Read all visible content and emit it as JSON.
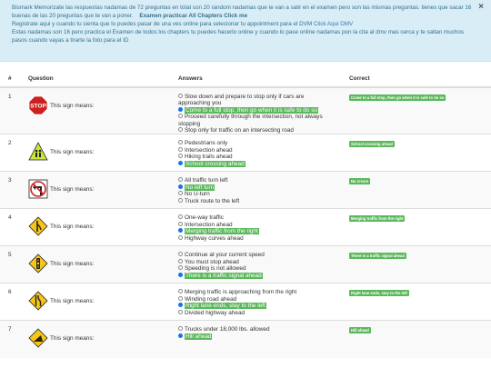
{
  "notice": {
    "line1": "Bismark Memorizate las respuestas nadamas de 72 preguntas en total son 20 random nadamas que te van a salir en el examen pero son las mismas preguntas. tienes que sacar 16 buenas de las 20 preguntas que te van a poner.",
    "cta": "Examen practicar All Chapters Click me",
    "line2": "Registrate aqui y cuando tu sienta que lo puedes pasar de una ves online para selecionar tu appointment para el DVM",
    "link": "Click Aqui DMV",
    "line3": "Estas nadamas son 16 pero practica el Examen de todos los chapters tu puedes hacerlo online y cuando lo pase online nadamas pon la cita al dmv mas cerca y te saltan muchos pasos cuando vayas a tirarte la foto para el ID",
    "close": "×"
  },
  "table": {
    "headers": [
      "#",
      "Question",
      "Answers",
      "Correct"
    ],
    "rows": [
      {
        "num": "1",
        "question": "This sign means:",
        "icon": "stop-sign-icon",
        "answers": [
          "Slow down and prepare to stop only if cars are approaching you",
          "Come to a full stop, then go when it is safe to do so",
          "Proceed carefully through the intersection, not always stopping",
          "Stop only for traffic on an intersecting road"
        ],
        "selected": 1,
        "correct": "Come to a full stop, then go when it is safe to do so"
      },
      {
        "num": "2",
        "question": "This sign means:",
        "icon": "school-crossing-sign-icon",
        "answers": [
          "Pedestrians only",
          "Intersection ahead",
          "Hiking trails ahead",
          "School crossing ahead"
        ],
        "selected": 3,
        "correct": "School crossing ahead"
      },
      {
        "num": "3",
        "question": "This sign means:",
        "icon": "no-left-turn-sign-icon",
        "answers": [
          "All traffic turn left",
          "No left turn",
          "No U-turn",
          "Truck route to the left"
        ],
        "selected": 1,
        "correct": "No U-turn"
      },
      {
        "num": "4",
        "question": "This sign means:",
        "icon": "merging-traffic-sign-icon",
        "answers": [
          "One-way traffic",
          "Intersection ahead",
          "Merging traffic from the right",
          "Highway curves ahead"
        ],
        "selected": 2,
        "correct": "Merging traffic from the right"
      },
      {
        "num": "5",
        "question": "This sign means:",
        "icon": "traffic-signal-ahead-sign-icon",
        "answers": [
          "Continue at your current speed",
          "You must stop ahead",
          "Speeding is not allowed",
          "There is a traffic signal ahead"
        ],
        "selected": 3,
        "correct": "There is a traffic signal ahead"
      },
      {
        "num": "6",
        "question": "This sign means:",
        "icon": "lane-ends-sign-icon",
        "answers": [
          "Merging traffic is approaching from the right",
          "Winding road ahead",
          "Right lane ends, stay to the left",
          "Divided highway ahead"
        ],
        "selected": 2,
        "correct": "Right lane ends, stay to the left"
      },
      {
        "num": "7",
        "question": "This sign means:",
        "icon": "hill-ahead-sign-icon",
        "answers": [
          "Trucks under 18,000 lbs. allowed",
          "Hill ahead"
        ],
        "selected": 1,
        "correct": "Hill ahead"
      }
    ]
  },
  "colors": {
    "alert_bg": "#d9edf7",
    "highlight": "#5cb85c",
    "stop_red": "#cc1f1f",
    "warning_yellow": "#f5c518"
  }
}
